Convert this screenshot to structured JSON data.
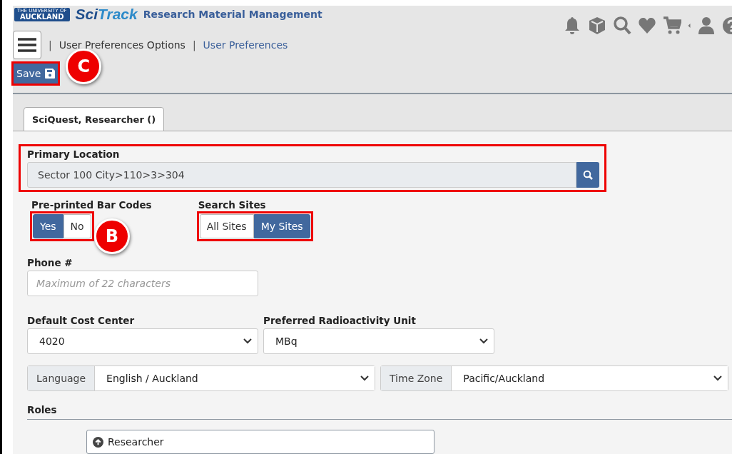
{
  "header": {
    "logo_top": "THE UNIVERSITY OF",
    "logo_bottom": "AUCKLAND",
    "brand_a": "Sci",
    "brand_b": "Track",
    "subtitle": "Research Material Management"
  },
  "breadcrumb": [
    {
      "separator": "|",
      "label": "User Preferences Options",
      "kind": "text"
    },
    {
      "separator": "|",
      "label": "User Preferences",
      "kind": "link"
    }
  ],
  "save_button": {
    "label": "Save",
    "highlighted": true
  },
  "callouts": [
    {
      "label": "C"
    },
    {
      "label": "B"
    }
  ],
  "tabs": [
    {
      "label": "SciQuest, Researcher ()",
      "selected": true
    }
  ],
  "primary_location": {
    "label": "Primary Location",
    "value": "Sector 100 City>110>3>304",
    "highlighted": true
  },
  "barcodes": {
    "label": "Pre-printed Bar Codes",
    "highlighted": true,
    "options": [
      {
        "label": "Yes",
        "selected": true
      },
      {
        "label": "No",
        "selected": false
      }
    ]
  },
  "search_sites": {
    "label": "Search Sites",
    "highlighted": true,
    "options": [
      {
        "label": "All Sites",
        "selected": false
      },
      {
        "label": "My Sites",
        "selected": true
      }
    ]
  },
  "phone": {
    "label": "Phone #",
    "placeholder": "Maximum of 22 characters"
  },
  "cost_center": {
    "label": "Default Cost Center",
    "value": "4020"
  },
  "radio_unit": {
    "label": "Preferred Radioactivity Unit",
    "value": "MBq"
  },
  "language": {
    "label": "Language",
    "value": "English / Auckland"
  },
  "time_zone": {
    "label": "Time Zone",
    "value": "Pacific/Auckland"
  },
  "roles": {
    "label": "Roles",
    "items": [
      {
        "label": "Researcher"
      }
    ]
  }
}
